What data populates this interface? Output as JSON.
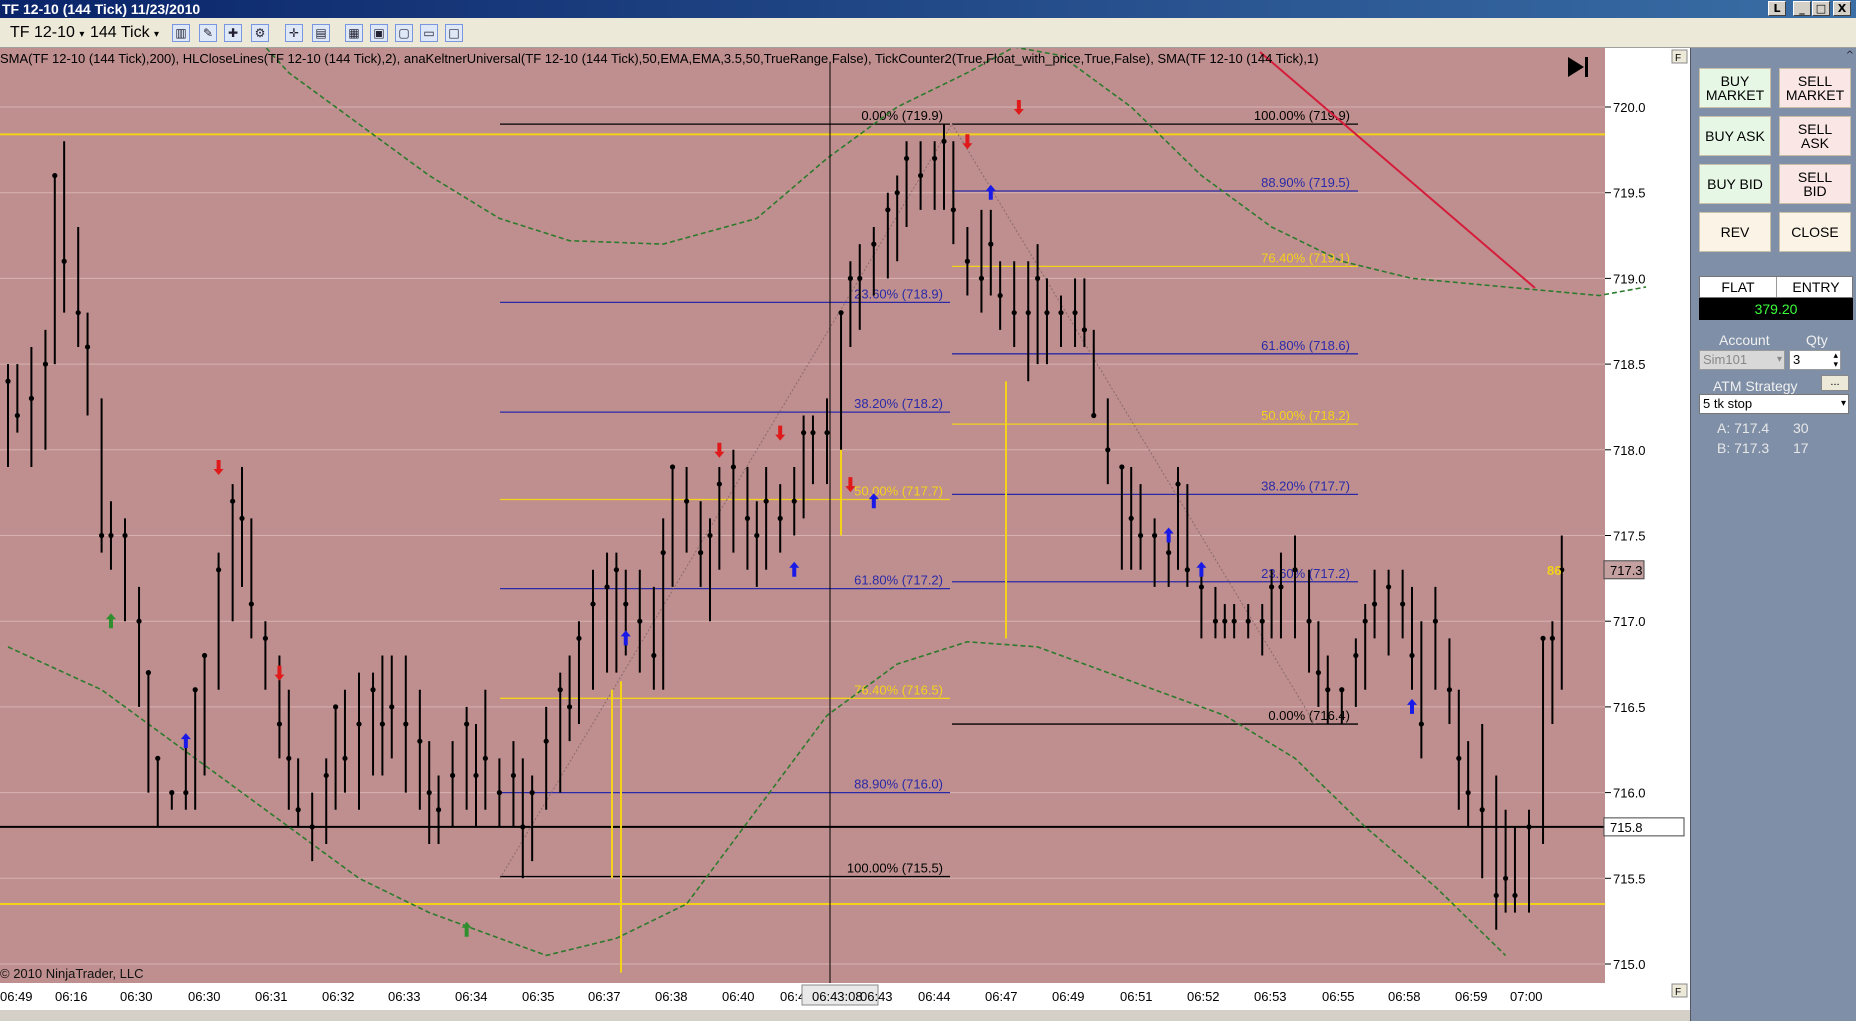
{
  "window": {
    "title": "TF 12-10 (144 Tick)  11/23/2010",
    "controls": [
      "L",
      "_",
      "□",
      "X"
    ]
  },
  "toolbar": {
    "instrument": "TF 12-10",
    "interval": "144 Tick"
  },
  "indicators_line": "SMA(TF  12-10  (144  Tick),200),  HLCloseLines(TF  12-10  (144  Tick),2),  anaKeltnerUniversal(TF  12-10  (144  Tick),50,EMA,EMA,3.5,50,TrueRange,False),  TickCounter2(True,Float_with_price,True,False),  SMA(TF  12-10  (144  Tick),1)",
  "copyright": "© 2010 NinjaTrader, LLC",
  "chart_data": {
    "type": "candlestick-bar",
    "y_axis": {
      "min": 715.0,
      "max": 720.0,
      "ticks": [
        "720.0",
        "719.5",
        "719.0",
        "718.5",
        "718.0",
        "717.5",
        "717.0",
        "716.5",
        "716.0",
        "715.5",
        "715.0"
      ]
    },
    "x_axis": {
      "ticks": [
        "06:49",
        "06:16",
        "06:30",
        "06:30",
        "06:31",
        "06:32",
        "06:33",
        "06:34",
        "06:35",
        "06:37",
        "06:38",
        "06:40",
        "06:4",
        "06:43:08",
        "06:43",
        "06:44",
        "06:47",
        "06:49",
        "06:51",
        "06:52",
        "06:53",
        "06:55",
        "06:58",
        "06:59",
        "07:00"
      ],
      "crosshair_label": "06:43:08"
    },
    "price_markers": [
      {
        "label": "717.3",
        "value": 717.3
      },
      {
        "label": "715.8",
        "value": 715.8
      }
    ],
    "tick_counter": "86",
    "horizontal_lines": [
      {
        "value": 719.84,
        "color": "#f4d21a"
      },
      {
        "value": 715.35,
        "color": "#f4d21a"
      },
      {
        "value": 715.8,
        "color": "#000000"
      }
    ],
    "fib_left": [
      {
        "label": "0.00% (719.9)",
        "value": 719.9,
        "color": "#000000"
      },
      {
        "label": "23.60% (718.9)",
        "value": 718.86,
        "color": "#2a2aa8"
      },
      {
        "label": "38.20% (718.2)",
        "value": 718.22,
        "color": "#2a2aa8"
      },
      {
        "label": "50.00% (717.7)",
        "value": 717.71,
        "color": "#f4d21a"
      },
      {
        "label": "61.80% (717.2)",
        "value": 717.19,
        "color": "#2a2aa8"
      },
      {
        "label": "76.40% (716.5)",
        "value": 716.55,
        "color": "#f4d21a"
      },
      {
        "label": "88.90% (716.0)",
        "value": 716.0,
        "color": "#2a2aa8"
      },
      {
        "label": "100.00% (715.5)",
        "value": 715.51,
        "color": "#000000"
      }
    ],
    "fib_right": [
      {
        "label": "100.00% (719.9)",
        "value": 719.9,
        "color": "#000000"
      },
      {
        "label": "88.90% (719.5)",
        "value": 719.51,
        "color": "#2a2aa8"
      },
      {
        "label": "76.40% (719.1)",
        "value": 719.07,
        "color": "#f4d21a"
      },
      {
        "label": "61.80% (718.6)",
        "value": 718.56,
        "color": "#2a2aa8"
      },
      {
        "label": "50.00% (718.2)",
        "value": 718.15,
        "color": "#f4d21a"
      },
      {
        "label": "38.20% (717.7)",
        "value": 717.74,
        "color": "#2a2aa8"
      },
      {
        "label": "23.60% (717.2)",
        "value": 717.23,
        "color": "#2a2aa8"
      },
      {
        "label": "0.00% (716.4)",
        "value": 716.4,
        "color": "#000000"
      }
    ],
    "keltner_upper": [
      [
        0,
        721.5
      ],
      [
        40,
        720.8
      ],
      [
        60,
        720.2
      ],
      [
        75,
        719.9
      ],
      [
        90,
        719.6
      ],
      [
        105,
        719.35
      ],
      [
        120,
        719.22
      ],
      [
        140,
        719.2
      ],
      [
        160,
        719.35
      ],
      [
        175,
        719.7
      ],
      [
        190,
        720.0
      ],
      [
        205,
        720.2
      ],
      [
        215,
        720.35
      ],
      [
        225,
        720.3
      ],
      [
        240,
        720.0
      ],
      [
        255,
        719.6
      ],
      [
        270,
        719.3
      ],
      [
        285,
        719.1
      ],
      [
        300,
        719.0
      ],
      [
        320,
        718.95
      ],
      [
        340,
        718.9
      ],
      [
        350,
        718.95
      ]
    ],
    "keltner_lower": [
      [
        0,
        716.85
      ],
      [
        20,
        716.6
      ],
      [
        40,
        716.2
      ],
      [
        60,
        715.8
      ],
      [
        75,
        715.5
      ],
      [
        90,
        715.3
      ],
      [
        105,
        715.15
      ],
      [
        115,
        715.05
      ],
      [
        130,
        715.15
      ],
      [
        145,
        715.35
      ],
      [
        160,
        715.9
      ],
      [
        175,
        716.45
      ],
      [
        190,
        716.75
      ],
      [
        205,
        716.88
      ],
      [
        220,
        716.85
      ],
      [
        235,
        716.7
      ],
      [
        250,
        716.55
      ],
      [
        260,
        716.45
      ],
      [
        275,
        716.2
      ],
      [
        290,
        715.8
      ],
      [
        305,
        715.45
      ],
      [
        320,
        715.05
      ]
    ],
    "bars": [
      [
        0,
        718.5,
        717.9,
        718.4
      ],
      [
        2,
        718.5,
        718.1,
        718.2
      ],
      [
        5,
        718.6,
        717.9,
        718.3
      ],
      [
        8,
        718.7,
        718.0,
        718.5
      ],
      [
        10,
        719.6,
        718.5,
        719.6
      ],
      [
        12,
        719.8,
        718.8,
        719.1
      ],
      [
        15,
        719.3,
        718.6,
        718.8
      ],
      [
        17,
        718.8,
        718.2,
        718.6
      ],
      [
        20,
        718.3,
        717.4,
        717.5
      ],
      [
        22,
        717.7,
        717.3,
        717.5
      ],
      [
        25,
        717.6,
        717.0,
        717.5
      ],
      [
        28,
        717.2,
        716.5,
        717.0
      ],
      [
        30,
        716.7,
        716.0,
        716.7
      ],
      [
        32,
        716.2,
        715.8,
        716.2
      ],
      [
        35,
        716.0,
        715.9,
        716.0
      ],
      [
        38,
        716.3,
        715.9,
        716.0
      ],
      [
        40,
        716.6,
        715.9,
        716.6
      ],
      [
        42,
        716.8,
        716.1,
        716.8
      ],
      [
        45,
        717.4,
        716.6,
        717.3
      ],
      [
        48,
        717.8,
        717.0,
        717.7
      ],
      [
        50,
        717.9,
        717.2,
        717.6
      ],
      [
        52,
        717.6,
        716.9,
        717.1
      ],
      [
        55,
        717.0,
        716.6,
        716.9
      ],
      [
        58,
        716.8,
        716.2,
        716.4
      ],
      [
        60,
        716.6,
        715.9,
        716.2
      ],
      [
        62,
        716.2,
        715.8,
        715.9
      ],
      [
        65,
        716.0,
        715.6,
        715.8
      ],
      [
        68,
        716.2,
        715.7,
        716.1
      ],
      [
        70,
        716.5,
        715.9,
        716.5
      ],
      [
        72,
        716.6,
        716.0,
        716.2
      ],
      [
        75,
        716.7,
        715.9,
        716.4
      ],
      [
        78,
        716.7,
        716.1,
        716.6
      ],
      [
        80,
        716.8,
        716.1,
        716.4
      ],
      [
        82,
        716.8,
        716.2,
        716.5
      ],
      [
        85,
        716.8,
        716.0,
        716.4
      ],
      [
        88,
        716.6,
        715.9,
        716.3
      ],
      [
        90,
        716.3,
        715.7,
        716.0
      ],
      [
        92,
        716.1,
        715.7,
        715.9
      ],
      [
        95,
        716.3,
        715.8,
        716.1
      ],
      [
        98,
        716.5,
        715.9,
        716.4
      ],
      [
        100,
        716.4,
        715.8,
        716.1
      ],
      [
        102,
        716.6,
        715.9,
        716.2
      ],
      [
        105,
        716.2,
        715.8,
        716.0
      ],
      [
        108,
        716.3,
        715.8,
        716.1
      ],
      [
        110,
        716.2,
        715.5,
        715.8
      ],
      [
        112,
        716.1,
        715.6,
        716.0
      ],
      [
        115,
        716.5,
        715.9,
        716.3
      ],
      [
        118,
        716.7,
        716.0,
        716.6
      ],
      [
        120,
        716.8,
        716.3,
        716.5
      ],
      [
        122,
        717.0,
        716.4,
        716.9
      ],
      [
        125,
        717.3,
        716.6,
        717.1
      ],
      [
        128,
        717.4,
        716.7,
        717.2
      ],
      [
        130,
        717.4,
        716.7,
        717.3
      ],
      [
        132,
        717.3,
        716.8,
        717.1
      ],
      [
        135,
        717.3,
        716.7,
        717.0
      ],
      [
        138,
        717.2,
        716.6,
        716.8
      ],
      [
        140,
        717.6,
        716.6,
        717.4
      ],
      [
        142,
        717.9,
        717.2,
        717.9
      ],
      [
        145,
        717.9,
        717.4,
        717.7
      ],
      [
        148,
        717.7,
        717.2,
        717.4
      ],
      [
        150,
        717.6,
        717.0,
        717.5
      ],
      [
        152,
        717.9,
        717.3,
        717.8
      ],
      [
        155,
        718.0,
        717.4,
        717.9
      ],
      [
        158,
        717.9,
        717.3,
        717.6
      ],
      [
        160,
        717.7,
        717.2,
        717.5
      ],
      [
        162,
        717.9,
        717.3,
        717.7
      ],
      [
        165,
        717.8,
        717.4,
        717.6
      ],
      [
        168,
        717.9,
        717.5,
        717.7
      ],
      [
        170,
        718.2,
        717.6,
        718.1
      ],
      [
        172,
        718.2,
        717.8,
        718.1
      ],
      [
        175,
        718.3,
        717.8,
        718.1
      ],
      [
        178,
        718.8,
        718.0,
        718.8
      ],
      [
        180,
        719.1,
        718.6,
        719.0
      ],
      [
        182,
        719.2,
        718.7,
        719.0
      ],
      [
        185,
        719.3,
        718.9,
        719.2
      ],
      [
        188,
        719.5,
        719.0,
        719.4
      ],
      [
        190,
        719.6,
        719.1,
        719.5
      ],
      [
        192,
        719.8,
        719.3,
        719.7
      ],
      [
        195,
        719.8,
        719.4,
        719.6
      ],
      [
        198,
        719.8,
        719.4,
        719.7
      ],
      [
        200,
        719.9,
        719.4,
        719.8
      ],
      [
        202,
        719.8,
        719.2,
        719.4
      ],
      [
        205,
        719.3,
        718.9,
        719.1
      ],
      [
        208,
        719.4,
        718.8,
        719.0
      ],
      [
        210,
        719.4,
        718.9,
        719.2
      ],
      [
        212,
        719.1,
        718.7,
        718.9
      ],
      [
        215,
        719.1,
        718.6,
        718.8
      ],
      [
        218,
        719.1,
        718.4,
        718.8
      ],
      [
        220,
        719.2,
        718.5,
        719.0
      ],
      [
        222,
        719.0,
        718.5,
        718.8
      ],
      [
        225,
        718.9,
        718.6,
        718.8
      ],
      [
        228,
        719.0,
        718.6,
        718.8
      ],
      [
        230,
        719.0,
        718.6,
        718.7
      ],
      [
        232,
        718.7,
        718.2,
        718.2
      ],
      [
        235,
        718.3,
        717.8,
        718.0
      ],
      [
        238,
        717.9,
        717.3,
        717.9
      ],
      [
        240,
        717.9,
        717.3,
        717.6
      ],
      [
        242,
        717.8,
        717.3,
        717.5
      ],
      [
        245,
        717.6,
        717.2,
        717.5
      ],
      [
        248,
        717.5,
        717.2,
        717.4
      ],
      [
        250,
        717.9,
        717.3,
        717.8
      ],
      [
        252,
        717.8,
        717.2,
        717.3
      ],
      [
        255,
        717.3,
        716.9,
        717.2
      ],
      [
        258,
        717.2,
        716.9,
        717.0
      ],
      [
        260,
        717.1,
        716.9,
        717.0
      ],
      [
        262,
        717.1,
        716.9,
        717.0
      ],
      [
        265,
        717.1,
        716.9,
        717.0
      ],
      [
        268,
        717.1,
        716.8,
        717.0
      ],
      [
        270,
        717.3,
        716.9,
        717.2
      ],
      [
        272,
        717.4,
        716.9,
        717.2
      ],
      [
        275,
        717.5,
        716.9,
        717.3
      ],
      [
        278,
        717.3,
        716.7,
        717.0
      ],
      [
        280,
        717.0,
        716.5,
        716.7
      ],
      [
        282,
        716.8,
        716.4,
        716.6
      ],
      [
        285,
        716.6,
        716.4,
        716.6
      ],
      [
        288,
        716.9,
        716.5,
        716.8
      ],
      [
        290,
        717.1,
        716.6,
        717.0
      ],
      [
        292,
        717.3,
        716.9,
        717.1
      ],
      [
        295,
        717.3,
        716.8,
        717.2
      ],
      [
        298,
        717.3,
        716.9,
        717.1
      ],
      [
        300,
        717.2,
        716.6,
        716.8
      ],
      [
        302,
        717.0,
        716.2,
        716.4
      ],
      [
        305,
        717.2,
        716.6,
        717.0
      ],
      [
        308,
        716.9,
        716.4,
        716.6
      ],
      [
        310,
        716.6,
        715.9,
        716.2
      ],
      [
        312,
        716.3,
        715.8,
        716.0
      ],
      [
        315,
        716.4,
        715.5,
        715.9
      ],
      [
        318,
        716.1,
        715.2,
        715.4
      ],
      [
        320,
        715.9,
        715.3,
        715.5
      ],
      [
        322,
        715.8,
        715.3,
        715.4
      ],
      [
        325,
        715.9,
        715.3,
        715.8
      ],
      [
        328,
        716.9,
        715.7,
        716.9
      ],
      [
        330,
        717.0,
        716.4,
        716.9
      ],
      [
        332,
        717.5,
        716.6,
        717.3
      ]
    ],
    "arrows": [
      {
        "i": 22,
        "value": 717.0,
        "dir": "up",
        "color": "#2f8f2f"
      },
      {
        "i": 38,
        "value": 716.3,
        "dir": "up",
        "color": "#1a1ae8"
      },
      {
        "i": 45,
        "value": 717.9,
        "dir": "down",
        "color": "#e01a1a"
      },
      {
        "i": 58,
        "value": 716.7,
        "dir": "down",
        "color": "#e01a1a"
      },
      {
        "i": 98,
        "value": 715.2,
        "dir": "up",
        "color": "#2f8f2f"
      },
      {
        "i": 132,
        "value": 716.9,
        "dir": "up",
        "color": "#1a1ae8"
      },
      {
        "i": 152,
        "value": 718.0,
        "dir": "down",
        "color": "#e01a1a"
      },
      {
        "i": 165,
        "value": 718.1,
        "dir": "down",
        "color": "#e01a1a"
      },
      {
        "i": 168,
        "value": 717.3,
        "dir": "up",
        "color": "#1a1ae8"
      },
      {
        "i": 180,
        "value": 717.8,
        "dir": "down",
        "color": "#e01a1a"
      },
      {
        "i": 185,
        "value": 717.7,
        "dir": "up",
        "color": "#1a1ae8"
      },
      {
        "i": 205,
        "value": 719.8,
        "dir": "down",
        "color": "#e01a1a"
      },
      {
        "i": 210,
        "value": 719.5,
        "dir": "up",
        "color": "#1a1ae8"
      },
      {
        "i": 216,
        "value": 720.0,
        "dir": "down",
        "color": "#e01a1a"
      },
      {
        "i": 248,
        "value": 717.5,
        "dir": "up",
        "color": "#1a1ae8"
      },
      {
        "i": 255,
        "value": 717.3,
        "dir": "up",
        "color": "#1a1ae8"
      },
      {
        "i": 300,
        "value": 716.5,
        "dir": "up",
        "color": "#1a1ae8"
      }
    ]
  },
  "panel": {
    "buttons": [
      {
        "name": "buy-market-button",
        "label": "BUY\nMARKET",
        "style": "green"
      },
      {
        "name": "sell-market-button",
        "label": "SELL\nMARKET",
        "style": "pink"
      },
      {
        "name": "buy-ask-button",
        "label": "BUY ASK",
        "style": "green"
      },
      {
        "name": "sell-ask-button",
        "label": "SELL\nASK",
        "style": "pink"
      },
      {
        "name": "buy-bid-button",
        "label": "BUY BID",
        "style": "green"
      },
      {
        "name": "sell-bid-button",
        "label": "SELL\nBID",
        "style": "pink"
      },
      {
        "name": "rev-button",
        "label": "REV",
        "style": "plain"
      },
      {
        "name": "close-button",
        "label": "CLOSE",
        "style": "plain"
      }
    ],
    "position_label": "FLAT",
    "entry_label": "ENTRY",
    "pnl": "379.20",
    "account_label": "Account",
    "qty_label": "Qty",
    "account_value": "Sim101",
    "qty_value": "3",
    "atm_label": "ATM Strategy",
    "atm_value": "5 tk stop",
    "quotes": [
      {
        "label": "A: 717.4",
        "size": "30"
      },
      {
        "label": "B: 717.3",
        "size": "17"
      }
    ]
  }
}
